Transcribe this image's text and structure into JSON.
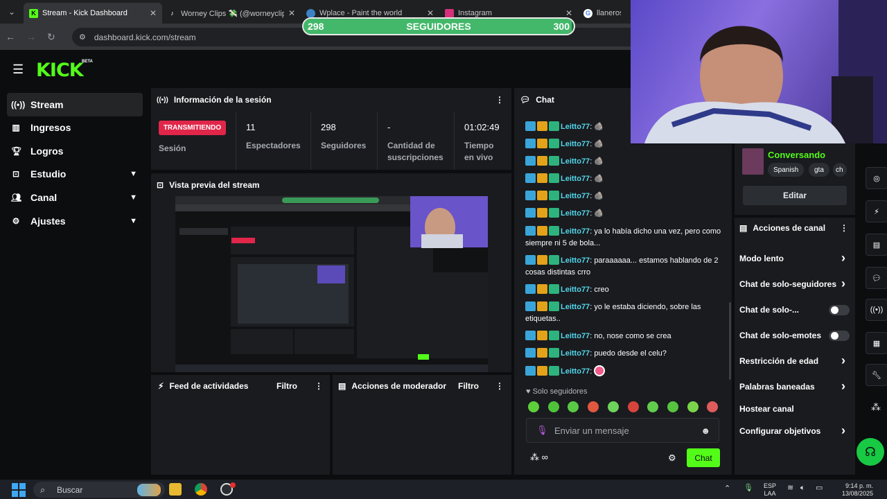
{
  "browser": {
    "tabs": [
      {
        "title": "Stream - Kick Dashboard",
        "active": true,
        "favicon": "kick-icon"
      },
      {
        "title": "Worney Clips 💸 (@worneyclips)",
        "active": false,
        "favicon": "tiktok-icon"
      },
      {
        "title": "Wplace - Paint the world",
        "active": false,
        "favicon": "globe-icon"
      },
      {
        "title": "Instagram",
        "active": false,
        "favicon": "instagram-icon"
      },
      {
        "title": "llaneros esp",
        "active": false,
        "favicon": "google-icon"
      }
    ],
    "url": "dashboard.kick.com/stream"
  },
  "overlay": {
    "follower_goal": {
      "current": "298",
      "label": "SEGUIDORES",
      "target": "300",
      "progress": 0.993
    }
  },
  "header": {
    "logo": "KICK",
    "beta": "BETA"
  },
  "sidebar": {
    "items": [
      {
        "label": "Stream",
        "icon": "stream-icon",
        "active": true,
        "expandable": false
      },
      {
        "label": "Ingresos",
        "icon": "chart-icon",
        "active": false,
        "expandable": false
      },
      {
        "label": "Logros",
        "icon": "trophy-icon",
        "active": false,
        "expandable": false
      },
      {
        "label": "Estudio",
        "icon": "studio-icon",
        "active": false,
        "expandable": true
      },
      {
        "label": "Canal",
        "icon": "users-icon",
        "active": false,
        "expandable": true
      },
      {
        "label": "Ajustes",
        "icon": "gear-icon",
        "active": false,
        "expandable": true
      }
    ]
  },
  "session": {
    "title": "Información de la sesión",
    "status_badge": "TRANSMITIENDO",
    "status_label": "Sesión",
    "stats": [
      {
        "value": "11",
        "label": "Espectadores"
      },
      {
        "value": "298",
        "label": "Seguidores"
      },
      {
        "value": "-",
        "label": "Cantidad de suscripciones"
      },
      {
        "value": "01:02:49",
        "label": "Tiempo en vivo"
      }
    ]
  },
  "preview": {
    "title": "Vista previa del stream"
  },
  "activity_feed": {
    "title": "Feed de actividades",
    "filter": "Filtro"
  },
  "mod_actions": {
    "title": "Acciones de moderador",
    "filter": "Filtro"
  },
  "chat": {
    "title": "Chat",
    "messages": [
      {
        "user": "Leitto77",
        "text": "🪨"
      },
      {
        "user": "Leitto77",
        "text": "🪨"
      },
      {
        "user": "Leitto77",
        "text": "🪨"
      },
      {
        "user": "Leitto77",
        "text": "🪨"
      },
      {
        "user": "Leitto77",
        "text": "🪨"
      },
      {
        "user": "Leitto77",
        "text": "🪨"
      },
      {
        "user": "Leitto77",
        "text": "ya lo había dicho una vez, pero como siempre ni 5 de bola..."
      },
      {
        "user": "Leitto77",
        "text": "paraaaaaa... estamos hablando de 2 cosas distintas crro"
      },
      {
        "user": "Leitto77",
        "text": "creo"
      },
      {
        "user": "Leitto77",
        "text": "yo le estaba diciendo, sobre las etiquetas.."
      },
      {
        "user": "Leitto77",
        "text": "no, nose como se crea"
      },
      {
        "user": "Leitto77",
        "text": "puedo desde el celu?"
      },
      {
        "user": "Leitto77",
        "text": ""
      }
    ],
    "followers_only": "Solo seguidores",
    "input_placeholder": "Enviar un mensaje",
    "send_label": "Chat"
  },
  "stream_info": {
    "category": "Conversando",
    "tags": [
      "Spanish",
      "gta",
      "ch"
    ],
    "edit_label": "Editar"
  },
  "channel_actions": {
    "title": "Acciones de canal",
    "items": [
      {
        "label": "Modo lento",
        "control": "chevron"
      },
      {
        "label": "Chat de solo-seguidores",
        "control": "chevron"
      },
      {
        "label": "Chat de solo-...",
        "control": "toggle"
      },
      {
        "label": "Chat de solo-emotes",
        "control": "toggle"
      },
      {
        "label": "Restricción de edad",
        "control": "chevron"
      },
      {
        "label": "Palabras baneadas",
        "control": "chevron"
      },
      {
        "label": "Hostear canal",
        "control": "none"
      },
      {
        "label": "Configurar objetivos",
        "control": "chevron"
      }
    ]
  },
  "taskbar": {
    "search_placeholder": "Buscar",
    "lang": "ESP",
    "lang_sub": "LAA",
    "time": "9:14 p. m.",
    "date": "13/08/2025"
  },
  "colors": {
    "accent": "#53fc18",
    "live": "#e1264a",
    "username": "#54d6ea"
  }
}
